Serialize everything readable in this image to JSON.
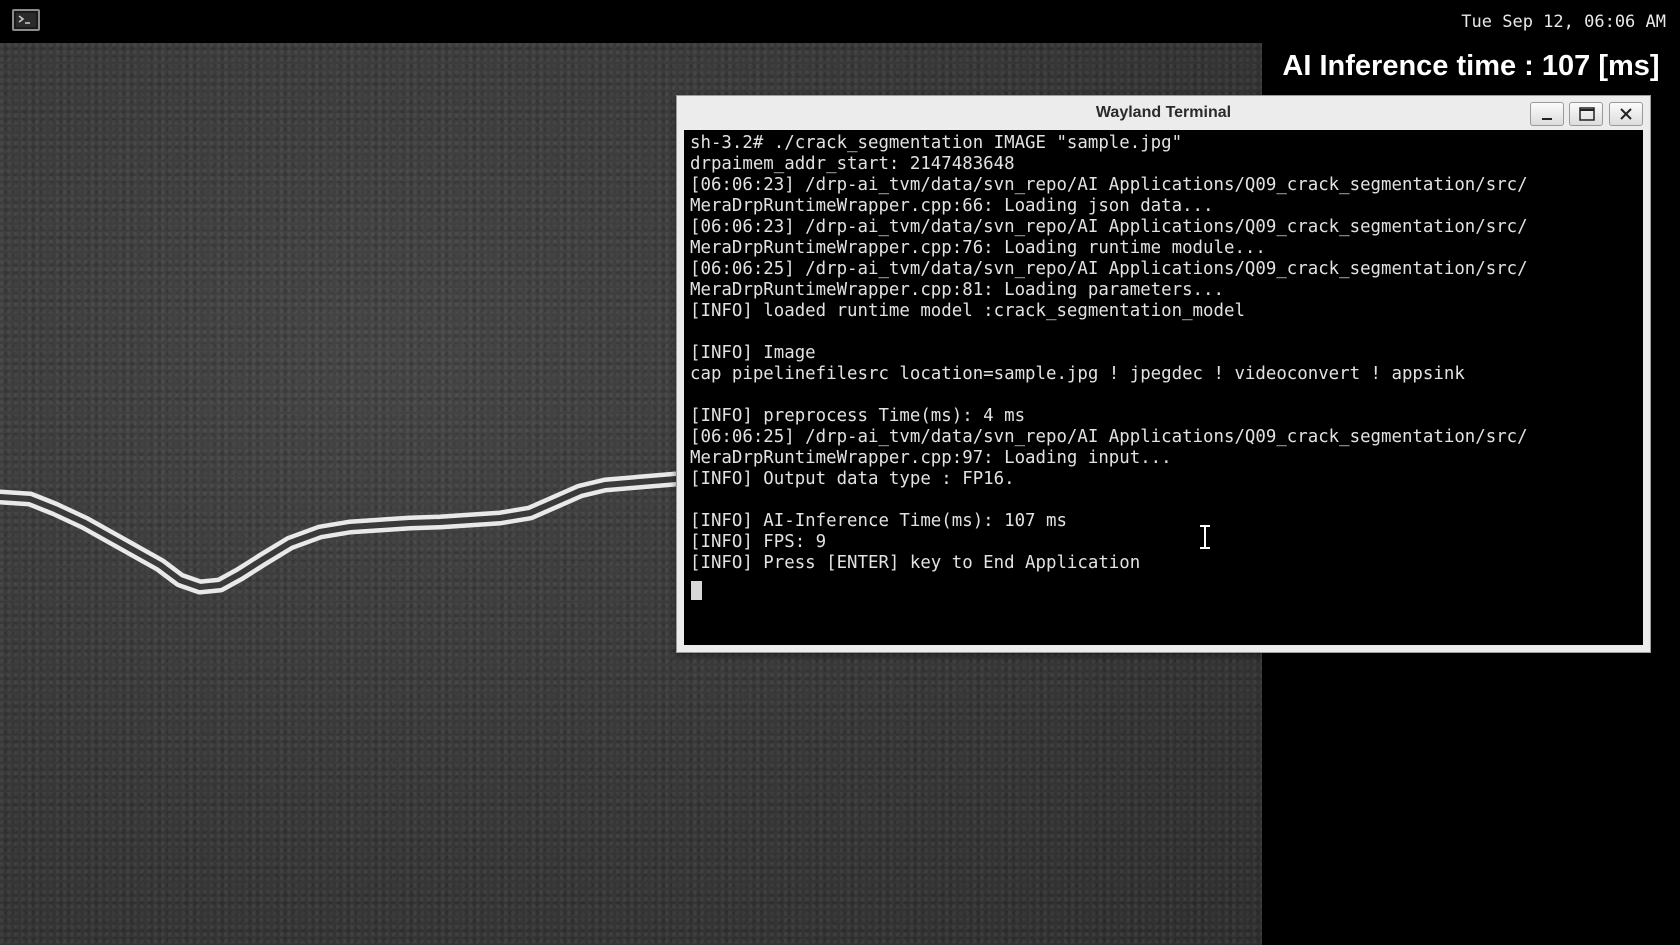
{
  "top_bar": {
    "launcher_icon": "terminal-icon",
    "clock": "Tue Sep 12, 06:06 AM"
  },
  "overlay": {
    "inference_text": "AI Inference time : 107 [ms]"
  },
  "terminal_window": {
    "title": "Wayland Terminal",
    "controls": [
      "minimize-icon",
      "maximize-icon",
      "close-icon"
    ],
    "lines": [
      "sh-3.2# ./crack_segmentation IMAGE \"sample.jpg\"",
      "drpaimem_addr_start: 2147483648",
      "[06:06:23] /drp-ai_tvm/data/svn_repo/AI Applications/Q09_crack_segmentation/src/",
      "MeraDrpRuntimeWrapper.cpp:66: Loading json data...",
      "[06:06:23] /drp-ai_tvm/data/svn_repo/AI Applications/Q09_crack_segmentation/src/",
      "MeraDrpRuntimeWrapper.cpp:76: Loading runtime module...",
      "[06:06:25] /drp-ai_tvm/data/svn_repo/AI Applications/Q09_crack_segmentation/src/",
      "MeraDrpRuntimeWrapper.cpp:81: Loading parameters...",
      "[INFO] loaded runtime model :crack_segmentation_model",
      "",
      "[INFO] Image",
      "cap pipelinefilesrc location=sample.jpg ! jpegdec ! videoconvert ! appsink",
      "",
      "[INFO] preprocess Time(ms): 4 ms",
      "[06:06:25] /drp-ai_tvm/data/svn_repo/AI Applications/Q09_crack_segmentation/src/",
      "MeraDrpRuntimeWrapper.cpp:97: Loading input...",
      "[INFO] Output data type : FP16.",
      "",
      "[INFO] AI-Inference Time(ms): 107 ms",
      "[INFO] FPS: 9",
      "[INFO] Press [ENTER] key to End Application"
    ]
  }
}
